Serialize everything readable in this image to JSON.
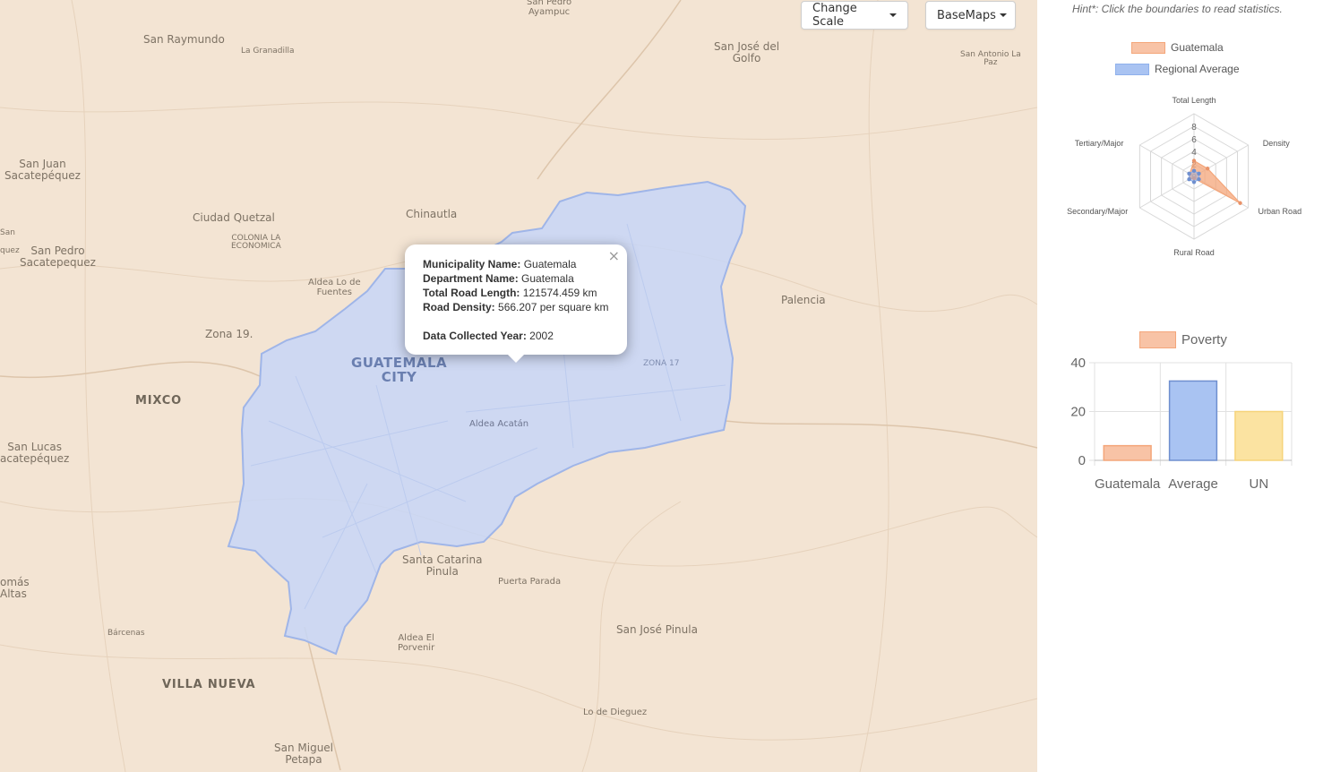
{
  "map": {
    "buttons": {
      "change_scale": "Change Scale",
      "basemaps": "BaseMaps"
    },
    "places": {
      "san_pedro_ayampuc": "San Pedro\nAyampuc",
      "san_raymundo": "San Raymundo",
      "la_granadilla": "La Granadilla",
      "san_jose_del_golfo": "San José del\nGolfo",
      "san_antonio_la_paz": "San Antonio La\nPaz",
      "san_juan_sacatepequez": "San Juan\nSacatepéquez",
      "ciudad_quetzal": "Ciudad Quetzal",
      "chinautla": "Chinautla",
      "colonia_economica": "COLONIA LA\nECONOMICA",
      "san_frag": "San",
      "quez_frag": "quez",
      "san_pedro_sacatepequez": "San Pedro\nSacatepequez",
      "aldea_lo_de_fuentes": "Aldea Lo de\nFuentes",
      "palencia": "Palencia",
      "zona_19": "Zona 19.",
      "guatemala_city": "GUATEMALA\nCITY",
      "zona_17": "ZONA 17",
      "mixco": "MIXCO",
      "aldea_acatan": "Aldea Acatán",
      "san_lucas": "San Lucas\nacatepéquez",
      "santa_catarina_pinula": "Santa Catarina\nPinula",
      "puerta_parada": "Puerta Parada",
      "tomas_frag": "omás\nAltas",
      "barcenas": "Bárcenas",
      "aldea_el_porvenir": "Aldea El\nPorvenir",
      "san_jose_pinula": "San José Pinula",
      "villa_nueva": "VILLA NUEVA",
      "lo_de_dieguez": "Lo de Dieguez",
      "san_miguel_petapa": "San Miguel\nPetapa"
    }
  },
  "popup": {
    "close_symbol": "×",
    "municipality_label": "Municipality Name:",
    "municipality_value": "Guatemala",
    "department_label": "Department Name:",
    "department_value": "Guatemala",
    "length_label": "Total Road Length:",
    "length_value": "121574.459 km",
    "density_label": "Road Density:",
    "density_value": "566.207 per square km",
    "year_label": "Data Collected Year:",
    "year_value": "2002"
  },
  "sidebar": {
    "hint": "Hint*: Click the boundaries to read statistics."
  },
  "colors": {
    "guatemala": "#f4a67a",
    "regional": "#8fb1ec",
    "un": "#fbe3a1",
    "region_fill": "#c7d6f7",
    "region_stroke": "#9fb5e8"
  },
  "chart_data": [
    {
      "type": "radar",
      "legend": [
        "Guatemala",
        "Regional Average"
      ],
      "axes": [
        "Total Length",
        "Density",
        "Urban Road",
        "Rural Road",
        "Secondary/Major",
        "Tertiary/Major"
      ],
      "r_ticks": [
        "0",
        "2",
        "4",
        "6",
        "8"
      ],
      "r_range": [
        0,
        8
      ],
      "series": [
        {
          "name": "Guatemala",
          "values": [
            2.5,
            2.5,
            8.5,
            0.3,
            0.8,
            0.8
          ]
        },
        {
          "name": "Regional Average",
          "values": [
            0.9,
            0.9,
            0.9,
            0.9,
            0.9,
            0.9
          ]
        }
      ]
    },
    {
      "type": "bar",
      "legend": [
        "Poverty"
      ],
      "categories": [
        "Guatemala",
        "Average",
        "UN"
      ],
      "values": [
        6,
        32.5,
        20
      ],
      "y_ticks": [
        "0",
        "20",
        "40"
      ],
      "ylim": [
        0,
        40
      ]
    }
  ]
}
